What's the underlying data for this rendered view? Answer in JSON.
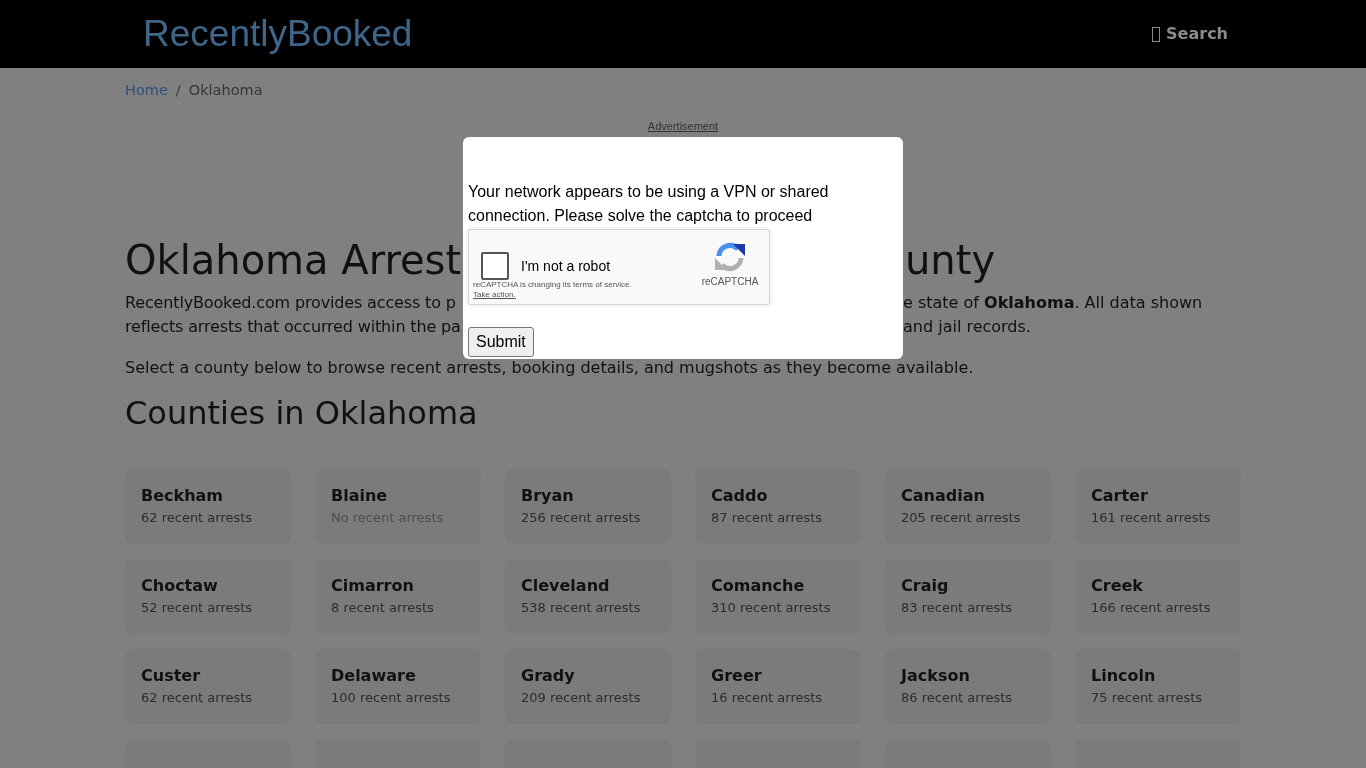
{
  "header": {
    "logo": "RecentlyBooked",
    "search_link": "Search"
  },
  "breadcrumb": {
    "separator": "/",
    "items": [
      {
        "label": "Home",
        "kind": "link"
      },
      {
        "label": "Oklahoma",
        "kind": "current"
      }
    ]
  },
  "advertisement": "Advertisement",
  "page_heading": {
    "visible_left": "Oklahoma Arrest",
    "visible_right": "unty"
  },
  "intro": {
    "lines": [
      {
        "left": "RecentlyBooked.com provides access to p",
        "right": "e state of **Oklahoma**. All data shown"
      },
      {
        "left": "reflects arrests that occurred within the pa",
        "right": "and jail records."
      }
    ],
    "note": "Select a county below to browse recent arrests, booking details, and mugshots as they become available."
  },
  "counties_heading": "Counties in Oklahoma",
  "counties": [
    {
      "kind": "county",
      "name": "Beckham",
      "arrests": "62 recent arrests",
      "muted": false
    },
    {
      "kind": "county",
      "name": "Blaine",
      "arrests": "No recent arrests",
      "muted": true
    },
    {
      "kind": "county",
      "name": "Bryan",
      "arrests": "256 recent arrests",
      "muted": false
    },
    {
      "kind": "county",
      "name": "Caddo",
      "arrests": "87 recent arrests",
      "muted": false
    },
    {
      "kind": "county",
      "name": "Canadian",
      "arrests": "205 recent arrests",
      "muted": false
    },
    {
      "kind": "county",
      "name": "Carter",
      "arrests": "161 recent arrests",
      "muted": false
    },
    {
      "kind": "county",
      "name": "Choctaw",
      "arrests": "52 recent arrests",
      "muted": false
    },
    {
      "kind": "county",
      "name": "Cimarron",
      "arrests": "8 recent arrests",
      "muted": false
    },
    {
      "kind": "county",
      "name": "Cleveland",
      "arrests": "538 recent arrests",
      "muted": false
    },
    {
      "kind": "county",
      "name": "Comanche",
      "arrests": "310 recent arrests",
      "muted": false
    },
    {
      "kind": "county",
      "name": "Craig",
      "arrests": "83 recent arrests",
      "muted": false
    },
    {
      "kind": "county",
      "name": "Creek",
      "arrests": "166 recent arrests",
      "muted": false
    },
    {
      "kind": "county",
      "name": "Custer",
      "arrests": "62 recent arrests",
      "muted": false
    },
    {
      "kind": "county",
      "name": "Delaware",
      "arrests": "100 recent arrests",
      "muted": false
    },
    {
      "kind": "county",
      "name": "Grady",
      "arrests": "209 recent arrests",
      "muted": false
    },
    {
      "kind": "county",
      "name": "Greer",
      "arrests": "16 recent arrests",
      "muted": false
    },
    {
      "kind": "county",
      "name": "Jackson",
      "arrests": "86 recent arrests",
      "muted": false
    },
    {
      "kind": "county",
      "name": "Lincoln",
      "arrests": "75 recent arrests",
      "muted": false
    },
    {
      "kind": "cut_off"
    },
    {
      "kind": "cut_off"
    },
    {
      "kind": "cut_off"
    },
    {
      "kind": "cut_off"
    },
    {
      "kind": "cut_off"
    },
    {
      "kind": "cut_off"
    }
  ],
  "captcha_dialog": {
    "message": "Your network appears to be using a VPN or shared connection. Please solve the captcha to proceed",
    "recaptcha": {
      "checkbox_label": "I'm not a robot",
      "checked": false,
      "notice": "reCAPTCHA is changing its terms of service.",
      "notice_link": "Take action.",
      "brand": "reCAPTCHA"
    },
    "submit_button": "Submit"
  }
}
